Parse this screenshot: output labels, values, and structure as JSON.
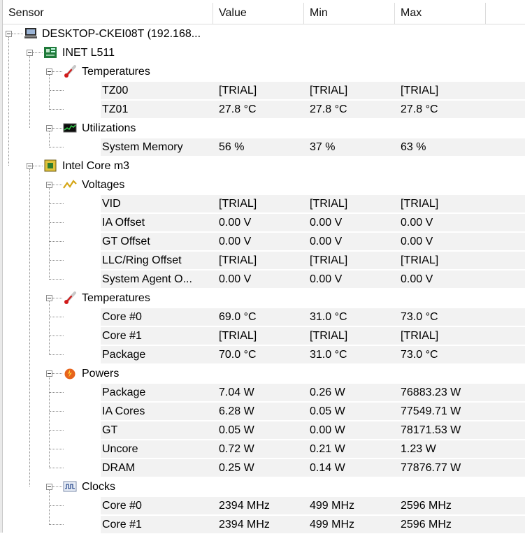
{
  "columns": {
    "sensor": "Sensor",
    "value": "Value",
    "min": "Min",
    "max": "Max"
  },
  "device": {
    "name": "DESKTOP-CKEI08T (192.168...",
    "icon": "computer-icon"
  },
  "groups": [
    {
      "name": "INET L511",
      "icon": "motherboard-icon",
      "sections": [
        {
          "name": "Temperatures",
          "icon": "thermometer-icon",
          "rows": [
            {
              "name": "TZ00",
              "value": "[TRIAL]",
              "min": "[TRIAL]",
              "max": "[TRIAL]"
            },
            {
              "name": "TZ01",
              "value": "27.8 °C",
              "min": "27.8 °C",
              "max": "27.8 °C"
            }
          ]
        },
        {
          "name": "Utilizations",
          "icon": "utilization-chart-icon",
          "rows": [
            {
              "name": "System Memory",
              "value": "56 %",
              "min": "37 %",
              "max": "63 %"
            }
          ]
        }
      ]
    },
    {
      "name": "Intel Core m3",
      "icon": "cpu-icon",
      "sections": [
        {
          "name": "Voltages",
          "icon": "voltage-icon",
          "rows": [
            {
              "name": "VID",
              "value": "[TRIAL]",
              "min": "[TRIAL]",
              "max": "[TRIAL]"
            },
            {
              "name": "IA Offset",
              "value": "0.00 V",
              "min": "0.00 V",
              "max": "0.00 V"
            },
            {
              "name": "GT Offset",
              "value": "0.00 V",
              "min": "0.00 V",
              "max": "0.00 V"
            },
            {
              "name": "LLC/Ring Offset",
              "value": "[TRIAL]",
              "min": "[TRIAL]",
              "max": "[TRIAL]"
            },
            {
              "name": "System Agent O...",
              "value": "0.00 V",
              "min": "0.00 V",
              "max": "0.00 V"
            }
          ]
        },
        {
          "name": "Temperatures",
          "icon": "thermometer-icon",
          "rows": [
            {
              "name": "Core #0",
              "value": "69.0 °C",
              "min": "31.0 °C",
              "max": "73.0 °C"
            },
            {
              "name": "Core #1",
              "value": "[TRIAL]",
              "min": "[TRIAL]",
              "max": "[TRIAL]"
            },
            {
              "name": "Package",
              "value": "70.0 °C",
              "min": "31.0 °C",
              "max": "73.0 °C"
            }
          ]
        },
        {
          "name": "Powers",
          "icon": "power-flame-icon",
          "rows": [
            {
              "name": "Package",
              "value": "7.04 W",
              "min": "0.26 W",
              "max": "76883.23 W"
            },
            {
              "name": "IA Cores",
              "value": "6.28 W",
              "min": "0.05 W",
              "max": "77549.71 W"
            },
            {
              "name": "GT",
              "value": "0.05 W",
              "min": "0.00 W",
              "max": "78171.53 W"
            },
            {
              "name": "Uncore",
              "value": "0.72 W",
              "min": "0.21 W",
              "max": "1.23 W"
            },
            {
              "name": "DRAM",
              "value": "0.25 W",
              "min": "0.14 W",
              "max": "77876.77 W"
            }
          ]
        },
        {
          "name": "Clocks",
          "icon": "clock-wave-icon",
          "rows": [
            {
              "name": "Core #0",
              "value": "2394 MHz",
              "min": "499 MHz",
              "max": "2596 MHz"
            },
            {
              "name": "Core #1",
              "value": "2394 MHz",
              "min": "499 MHz",
              "max": "2596 MHz"
            }
          ]
        }
      ]
    }
  ]
}
